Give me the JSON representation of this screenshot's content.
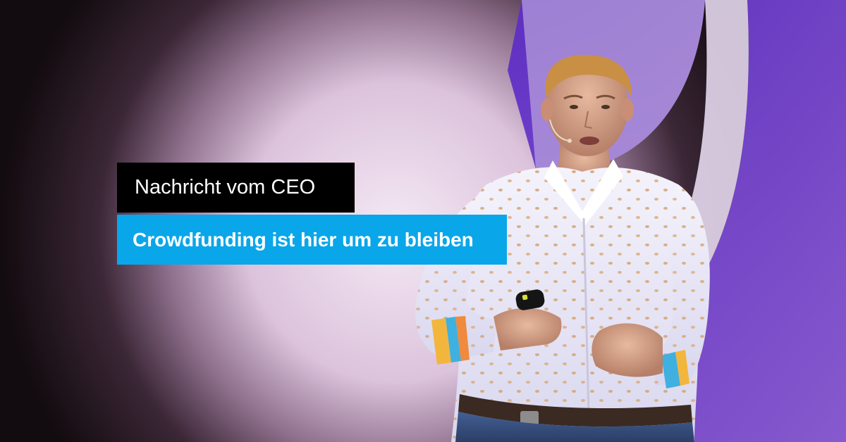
{
  "headline_label": "Nachricht vom CEO",
  "headline_title": "Crowdfunding ist hier um zu bleiben",
  "colors": {
    "label_background": "#000000",
    "title_background": "#0aa6ea",
    "stage_background": "#6b3fc9",
    "text": "#ffffff"
  }
}
